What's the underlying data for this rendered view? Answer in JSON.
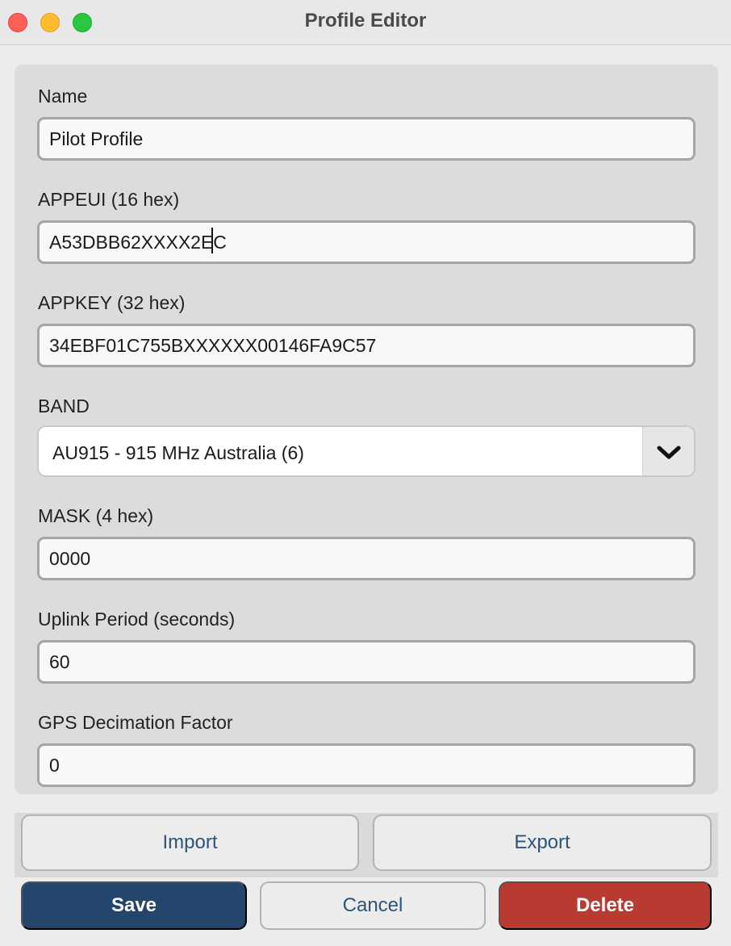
{
  "window": {
    "title": "Profile Editor"
  },
  "form": {
    "name": {
      "label": "Name",
      "value": "Pilot Profile"
    },
    "appeui": {
      "label": "APPEUI (16 hex)",
      "value": "A53DBB62XXXX2EC"
    },
    "appkey": {
      "label": "APPKEY (32 hex)",
      "value": "34EBF01C755BXXXXXX00146FA9C57"
    },
    "band": {
      "label": "BAND",
      "selected": "AU915 - 915 MHz Australia (6)",
      "icon": "chevron-down-icon"
    },
    "mask": {
      "label": "MASK (4 hex)",
      "value": "0000"
    },
    "uplink": {
      "label": "Uplink Period (seconds)",
      "value": "60"
    },
    "gps": {
      "label": "GPS Decimation Factor",
      "value": "0"
    }
  },
  "buttons": {
    "import": "Import",
    "export": "Export",
    "save": "Save",
    "cancel": "Cancel",
    "delete": "Delete"
  },
  "colors": {
    "save": "#24466d",
    "delete": "#b83a31",
    "link_text": "#2e5379",
    "close": "#fe5f57",
    "minimize": "#febc2e",
    "maximize": "#28c840"
  }
}
